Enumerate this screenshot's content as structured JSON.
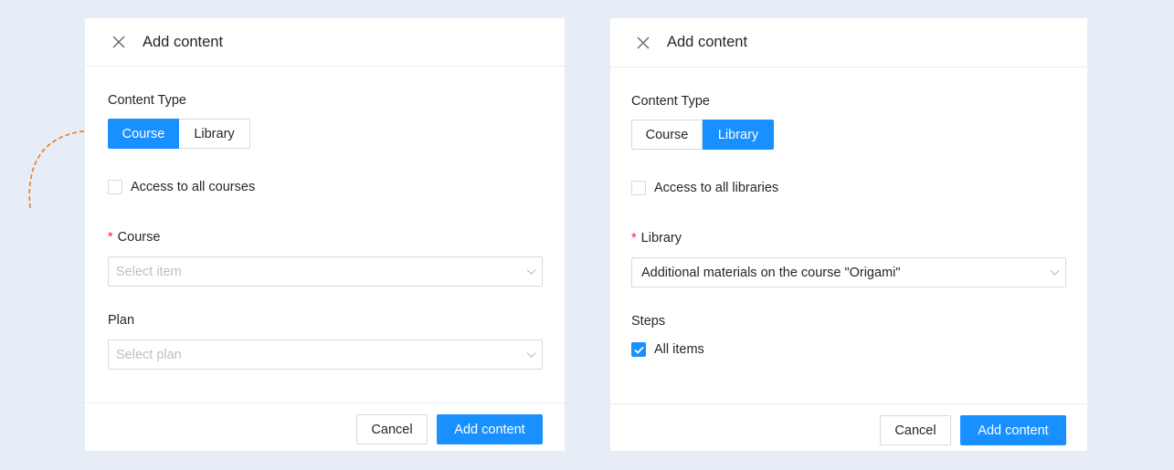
{
  "colors": {
    "accent": "#1890ff",
    "annotation_arrow": "#e67e22",
    "background": "#e7edf6"
  },
  "left_panel": {
    "title": "Add content",
    "close_icon": "close-icon",
    "content_type_label": "Content Type",
    "segments": [
      {
        "label": "Course",
        "active": true
      },
      {
        "label": "Library",
        "active": false
      }
    ],
    "access_checkbox": {
      "label": "Access to all courses",
      "checked": false
    },
    "course_field": {
      "label": "Course",
      "required": true,
      "placeholder": "Select item"
    },
    "plan_field": {
      "label": "Plan",
      "placeholder": "Select plan"
    },
    "footer": {
      "cancel_label": "Cancel",
      "submit_label": "Add content"
    }
  },
  "right_panel": {
    "title": "Add content",
    "close_icon": "close-icon",
    "content_type_label": "Content Type",
    "segments": [
      {
        "label": "Course",
        "active": false
      },
      {
        "label": "Library",
        "active": true
      }
    ],
    "access_checkbox": {
      "label": "Access to all libraries",
      "checked": false
    },
    "library_field": {
      "label": "Library",
      "required": true,
      "value": "Additional materials on the course \"Origami\""
    },
    "steps": {
      "label": "Steps",
      "all_items_label": "All items",
      "all_items_checked": true
    },
    "footer": {
      "cancel_label": "Cancel",
      "submit_label": "Add content"
    }
  }
}
